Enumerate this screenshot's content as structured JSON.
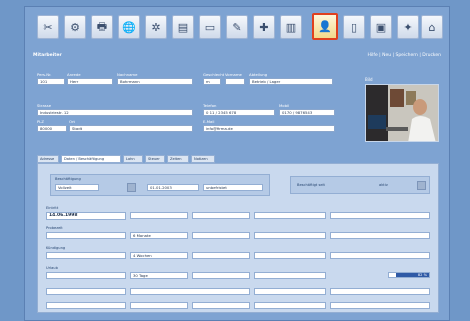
{
  "toolbar": {
    "buttons": [
      {
        "icon": "scissors-icon",
        "glyph": "✂"
      },
      {
        "icon": "gear-icon",
        "glyph": "⚙"
      },
      {
        "icon": "printer-icon",
        "glyph": "🖶"
      },
      {
        "icon": "globe-icon",
        "glyph": "🌐"
      },
      {
        "icon": "network-icon",
        "glyph": "✲"
      },
      {
        "icon": "document-icon",
        "glyph": "▤"
      },
      {
        "icon": "folder-icon",
        "glyph": "▭"
      },
      {
        "icon": "pencil-icon",
        "glyph": "✎"
      },
      {
        "icon": "tools-icon",
        "glyph": "✚"
      },
      {
        "icon": "book-icon",
        "glyph": "▥"
      },
      {
        "icon": "person-icon",
        "glyph": "👤",
        "active": true
      },
      {
        "icon": "page-icon",
        "glyph": "▯"
      },
      {
        "icon": "image-icon",
        "glyph": "▣"
      },
      {
        "icon": "settings-icon",
        "glyph": "✦"
      },
      {
        "icon": "bookmark-icon",
        "glyph": "⌂"
      }
    ]
  },
  "header": {
    "title": "Mitarbeiter",
    "actions": "Hilfe | Neu | Speichern | Drucken"
  },
  "person": {
    "labels": {
      "pers_nr": "Pers.Nr.",
      "anrede": "Anrede",
      "nachname": "Nachname",
      "vorname": "Vorname",
      "geschlecht": "Geschlecht",
      "abteilung": "Abteilung",
      "strasse": "Strasse",
      "plz": "PLZ",
      "ort": "Ort",
      "telefon": "Telefon",
      "mobil": "Mobil",
      "email": "E-Mail"
    },
    "pers_nr": "101",
    "anrede": "Herr",
    "nachname": "Bohrmann",
    "vorname": "",
    "geschlecht": "m",
    "abteilung": "Betrieb / Lager",
    "strasse": "Industriestr. 12",
    "plz": "80000",
    "ort": "Stadt",
    "telefon": "0 11 / 2345 678",
    "mobil": "0170 / 9876543",
    "email": "info@firma.de"
  },
  "photo": {
    "label": "Bild"
  },
  "tabs": [
    "Adresse",
    "Daten / Beschäftigung",
    "Lohn",
    "Steuer",
    "Zeiten",
    "Notizen"
  ],
  "tab_selected_index": 1,
  "detail": {
    "group_label": "Beschäftigung",
    "group_values": [
      "Vollzeit",
      "01.01.2003",
      "unbefristet"
    ],
    "status_label": "Beschäftigt seit",
    "status_value": "aktiv",
    "rows": [
      {
        "label": "Eintritt",
        "value": "14.06.1998"
      },
      {
        "label": "Probezeit",
        "value": "6 Monate"
      },
      {
        "label": "Kündigung",
        "value": "4 Wochen"
      },
      {
        "label": "Urlaub",
        "value": "30 Tage"
      }
    ],
    "progress_value": "82 %",
    "progress_fraction": 0.82
  }
}
